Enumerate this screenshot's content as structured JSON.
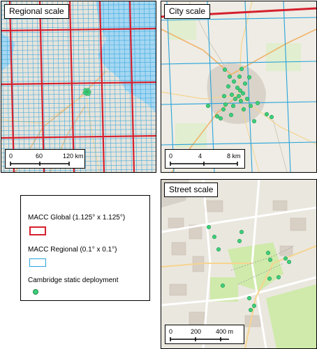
{
  "panels": {
    "regional": {
      "title": "Regional scale",
      "scale_labels": [
        "0",
        "60",
        "120 km"
      ]
    },
    "city": {
      "title": "City scale",
      "scale_labels": [
        "0",
        "4",
        "8 km"
      ]
    },
    "street": {
      "title": "Street scale",
      "scale_labels": [
        "0",
        "200",
        "400 m"
      ]
    }
  },
  "legend": {
    "items": [
      {
        "label": "MACC Global (1.125° x 1.125°)",
        "symbol": "red-box"
      },
      {
        "label": "MACC Regional (0.1° x 0.1°)",
        "symbol": "blue-box"
      },
      {
        "label": "Cambridge static deployment",
        "symbol": "green-dot"
      }
    ]
  },
  "colors": {
    "global_grid": "#d5202e",
    "regional_grid": "#29a3dc",
    "sea": "#a6d7f2",
    "land": "#e6e4dc",
    "sensor": "#3fce7b",
    "sensor_stroke": "#1f8a4a"
  }
}
